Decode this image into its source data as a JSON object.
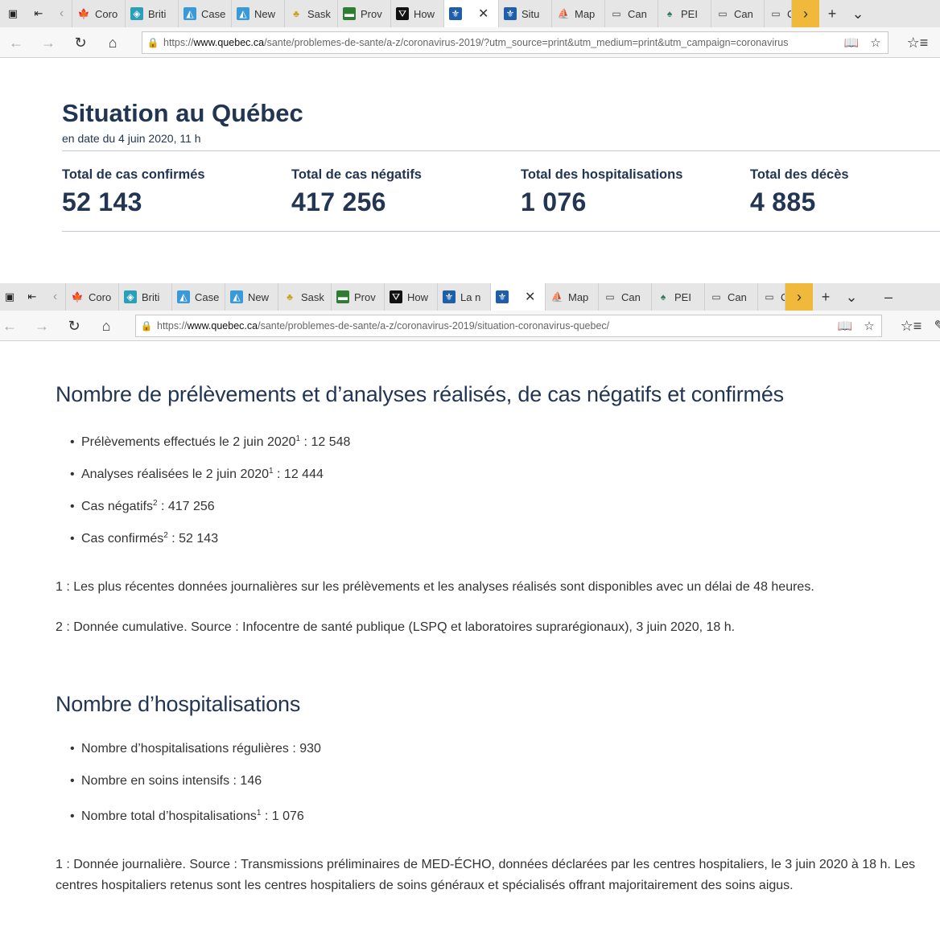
{
  "browser": {
    "tabs_top": [
      {
        "label": "Coro",
        "icon": "maple-leaf-icon"
      },
      {
        "label": "Briti",
        "icon": "bc-shield-icon"
      },
      {
        "label": "Case",
        "icon": "alberta-icon"
      },
      {
        "label": "New",
        "icon": "alberta-icon"
      },
      {
        "label": "Sask",
        "icon": "wheat-icon"
      },
      {
        "label": "Prov",
        "icon": "manitoba-icon"
      },
      {
        "label": "How",
        "icon": "ontario-icon"
      },
      {
        "label": "",
        "icon": "fleur-de-lis-icon",
        "active": true
      },
      {
        "label": "Situ",
        "icon": "fleur-de-lis-icon"
      },
      {
        "label": "Map",
        "icon": "nb-ship-icon"
      },
      {
        "label": "Can",
        "icon": "page-icon"
      },
      {
        "label": "PEI",
        "icon": "pei-icon"
      },
      {
        "label": "Can",
        "icon": "page-icon"
      },
      {
        "label": "C",
        "icon": "page-icon"
      }
    ],
    "tabs_bottom": [
      {
        "label": "Coro",
        "icon": "maple-leaf-icon"
      },
      {
        "label": "Briti",
        "icon": "bc-shield-icon"
      },
      {
        "label": "Case",
        "icon": "alberta-icon"
      },
      {
        "label": "New",
        "icon": "alberta-icon"
      },
      {
        "label": "Sask",
        "icon": "wheat-icon"
      },
      {
        "label": "Prov",
        "icon": "manitoba-icon"
      },
      {
        "label": "How",
        "icon": "ontario-icon"
      },
      {
        "label": "La n",
        "icon": "fleur-de-lis-icon"
      },
      {
        "label": "",
        "icon": "fleur-de-lis-icon",
        "active": true
      },
      {
        "label": "Map",
        "icon": "nb-ship-icon"
      },
      {
        "label": "Can",
        "icon": "page-icon"
      },
      {
        "label": "PEI",
        "icon": "pei-icon"
      },
      {
        "label": "Can",
        "icon": "page-icon"
      },
      {
        "label": "C",
        "icon": "page-icon"
      }
    ],
    "url_top_prefix": "https://",
    "url_top_domain": "www.quebec.ca",
    "url_top_path": "/sante/problemes-de-sante/a-z/coronavirus-2019/?utm_source=print&utm_medium=print&utm_campaign=coronavirus",
    "url_bottom_prefix": "https://",
    "url_bottom_domain": "www.quebec.ca",
    "url_bottom_path": "/sante/problemes-de-sante/a-z/coronavirus-2019/situation-coronavirus-quebec/",
    "accent_color": "#f0b93b"
  },
  "situation": {
    "title": "Situation au Québec",
    "date": "en date du 4 juin 2020, 11 h",
    "stats": [
      {
        "label": "Total de cas confirmés",
        "value": "52 143"
      },
      {
        "label": "Total de cas négatifs",
        "value": "417 256"
      },
      {
        "label": "Total des hospitalisations",
        "value": "1 076"
      },
      {
        "label": "Total des décès",
        "value": "4 885"
      }
    ]
  },
  "tests": {
    "heading": "Nombre de prélèvements et d’analyses réalisés, de cas négatifs et confirmés",
    "items": [
      {
        "text": "Prélèvements effectués le 2 juin 2020",
        "sup": "1",
        "value": " : 12 548"
      },
      {
        "text": "Analyses réalisées le 2 juin 2020",
        "sup": "1",
        "value": " : 12 444"
      },
      {
        "text": "Cas négatifs",
        "sup": "2",
        "value": " : 417 256"
      },
      {
        "text": "Cas confirmés",
        "sup": "2",
        "value": " : 52 143"
      }
    ],
    "note1": "1 : Les plus récentes données journalières sur les prélèvements et les analyses réalisés sont disponibles avec un délai de 48 heures.",
    "note2": "2 : Donnée cumulative. Source : Infocentre de santé publique (LSPQ et laboratoires suprarégionaux), 3 juin 2020, 18 h."
  },
  "hosp": {
    "heading": "Nombre d’hospitalisations",
    "items": [
      {
        "text": "Nombre d’hospitalisations régulières : 930",
        "sup": "",
        "value": ""
      },
      {
        "text": "Nombre en soins intensifs : 146",
        "sup": "",
        "value": ""
      },
      {
        "text": "Nombre total d’hospitalisations",
        "sup": "1",
        "value": " : 1 076"
      }
    ],
    "note_line1": "1 : Donnée journalière. Source : Transmissions préliminaires de MED-ÉCHO, données déclarées par les centres hospitaliers, le 3 juin 2020 à 18 h. Les",
    "note_line2": "centres hospitaliers retenus sont les centres hospitaliers de soins généraux et spécialisés offrant majoritairement des soins aigus."
  }
}
